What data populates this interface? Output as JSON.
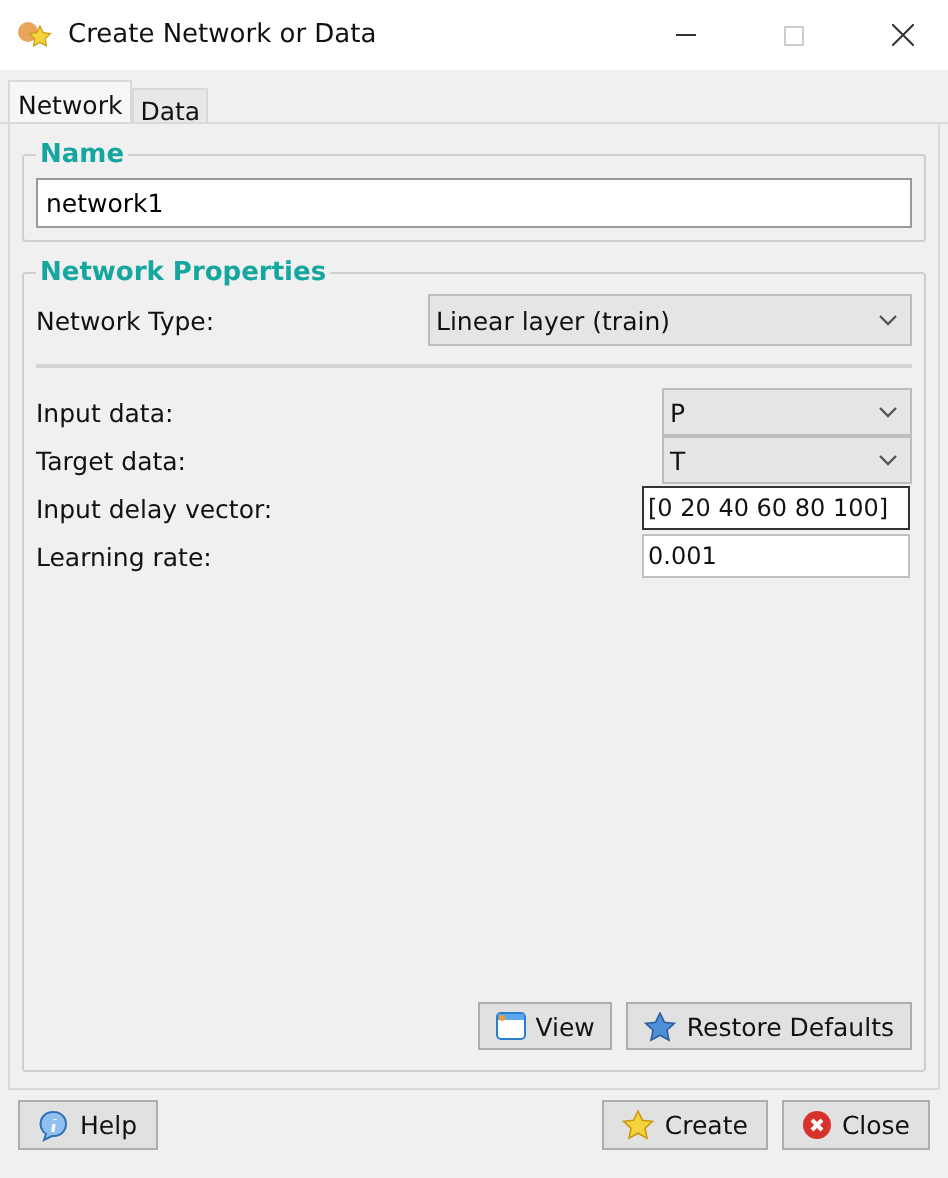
{
  "window": {
    "title": "Create Network or Data"
  },
  "tabs": [
    {
      "label": "Network",
      "selected": true
    },
    {
      "label": "Data",
      "selected": false
    }
  ],
  "name_group": {
    "title": "Name",
    "value": "network1"
  },
  "properties_group": {
    "title": "Network Properties",
    "network_type": {
      "label": "Network Type:",
      "value": "Linear layer (train)"
    },
    "fields": [
      {
        "kind": "select",
        "label": "Input data:",
        "value": "P",
        "focused": false
      },
      {
        "kind": "select",
        "label": "Target data:",
        "value": "T",
        "focused": false
      },
      {
        "kind": "text",
        "label": "Input delay vector:",
        "value": "[0 20 40 60 80 100]",
        "focused": true
      },
      {
        "kind": "text",
        "label": "Learning rate:",
        "value": "0.001",
        "focused": false
      }
    ],
    "buttons": [
      {
        "kind": "view",
        "label": "View"
      },
      {
        "kind": "restore",
        "label": "Restore Defaults"
      }
    ]
  },
  "footer": {
    "left": [
      {
        "kind": "help",
        "label": "Help"
      }
    ],
    "right": [
      {
        "kind": "create",
        "label": "Create"
      },
      {
        "kind": "close",
        "label": "Close"
      }
    ]
  }
}
